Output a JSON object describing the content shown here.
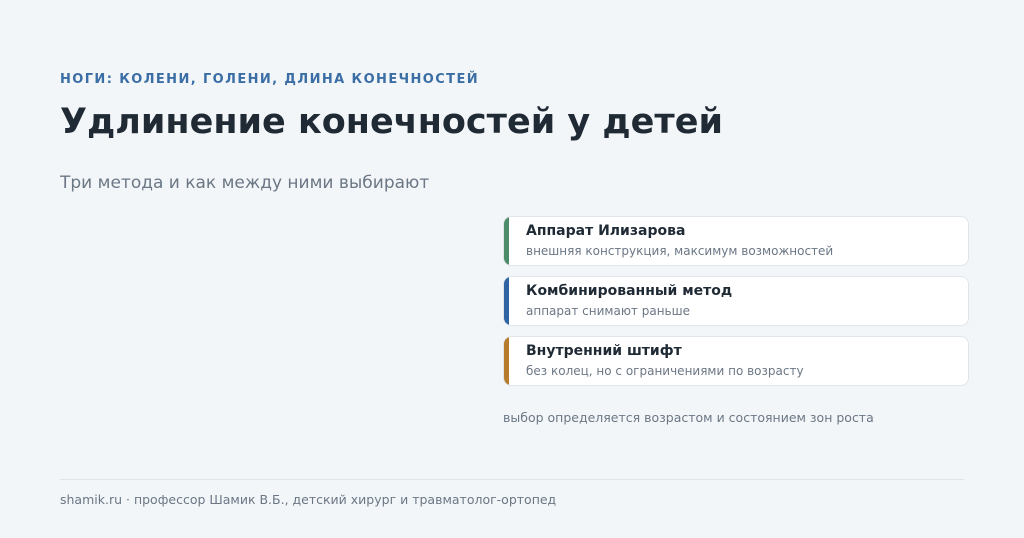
{
  "header": {
    "eyebrow": "НОГИ: КОЛЕНИ, ГОЛЕНИ, ДЛИНА КОНЕЧНОСТЕЙ",
    "title": "Удлинение конечностей у детей",
    "subtitle": "Три метода и как между ними выбирают"
  },
  "methods": [
    {
      "title": "Аппарат Илизарова",
      "description": "внешняя конструкция, максимум возможностей",
      "accent_color": "#4d8c69"
    },
    {
      "title": "Комбинированный метод",
      "description": "аппарат снимают раньше",
      "accent_color": "#2f64a3"
    },
    {
      "title": "Внутренний штифт",
      "description": "без колец, но с ограничениями по возрасту",
      "accent_color": "#b77b2e"
    }
  ],
  "note": "выбор определяется возрастом и состоянием зон роста",
  "footer": {
    "text": "shamik.ru · профессор Шамик В.Б., детский хирург и травматолог-ортопед"
  }
}
